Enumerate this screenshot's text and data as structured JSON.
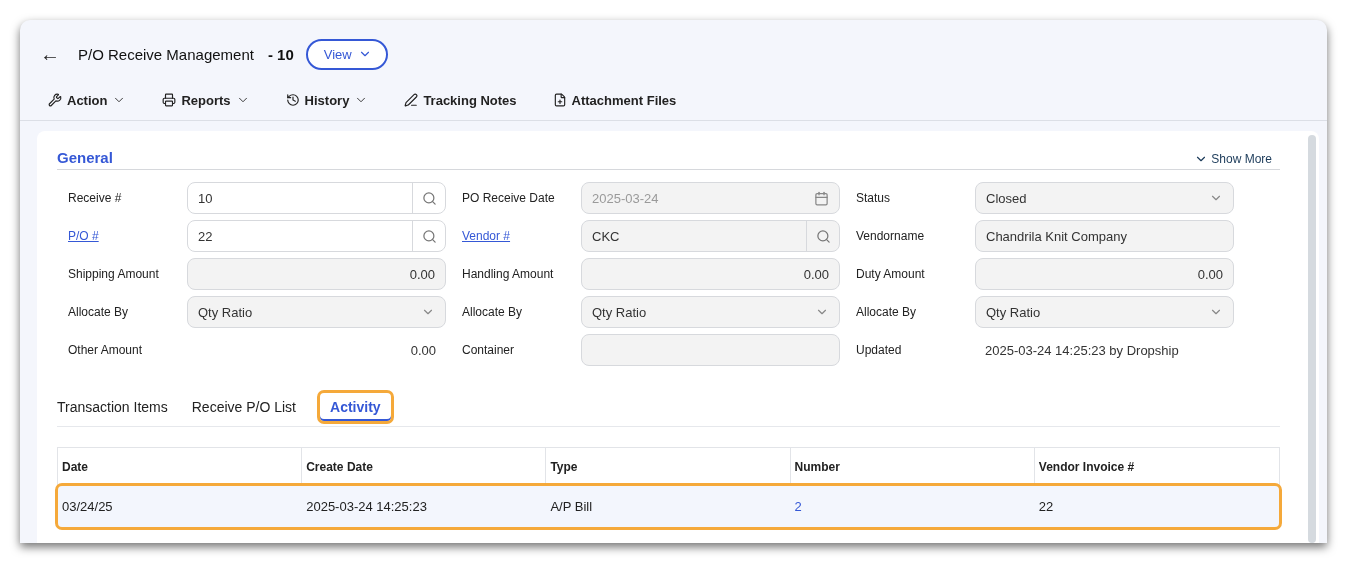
{
  "header": {
    "back": "←",
    "title": "P/O Receive Management",
    "record": "- 10",
    "view_button": "View"
  },
  "toolbar": [
    {
      "kind": "wrench",
      "label": "Action",
      "dropdown": true
    },
    {
      "kind": "printer",
      "label": "Reports",
      "dropdown": true
    },
    {
      "kind": "history",
      "label": "History",
      "dropdown": true
    },
    {
      "kind": "pen",
      "label": "Tracking Notes",
      "dropdown": false
    },
    {
      "kind": "file",
      "label": "Attachment Files",
      "dropdown": false
    }
  ],
  "section": {
    "title": "General",
    "show_more": "Show More"
  },
  "fields": [
    {
      "label": "Receive #",
      "link": false,
      "kind": "search",
      "value": "10",
      "disabled": false
    },
    {
      "label": "PO Receive Date",
      "link": false,
      "kind": "date",
      "value": "2025-03-24",
      "disabled": true
    },
    {
      "label": "Status",
      "link": false,
      "kind": "select",
      "value": "Closed",
      "disabled": true
    },
    {
      "label": "P/O #",
      "link": true,
      "kind": "search",
      "value": "22",
      "disabled": false
    },
    {
      "label": "Vendor #",
      "link": true,
      "kind": "search",
      "value": "CKC",
      "disabled": true
    },
    {
      "label": "Vendorname",
      "link": false,
      "kind": "text",
      "value": "Chandrila Knit Company",
      "disabled": true
    },
    {
      "label": "Shipping Amount",
      "link": false,
      "kind": "amount",
      "value": "0.00",
      "disabled": true
    },
    {
      "label": "Handling Amount",
      "link": false,
      "kind": "amount",
      "value": "0.00",
      "disabled": true
    },
    {
      "label": "Duty Amount",
      "link": false,
      "kind": "amount",
      "value": "0.00",
      "disabled": true
    },
    {
      "label": "Allocate By",
      "link": false,
      "kind": "select",
      "value": "Qty Ratio",
      "disabled": true
    },
    {
      "label": "Allocate By",
      "link": false,
      "kind": "select",
      "value": "Qty Ratio",
      "disabled": true
    },
    {
      "label": "Allocate By",
      "link": false,
      "kind": "select",
      "value": "Qty Ratio",
      "disabled": true
    },
    {
      "label": "Other Amount",
      "link": false,
      "kind": "plain-amount",
      "value": "0.00"
    },
    {
      "label": "Container",
      "link": false,
      "kind": "text",
      "disabled": true
    },
    {
      "label": "Updated",
      "link": false,
      "kind": "plain",
      "value": "2025-03-24 14:25:23 by Dropship"
    }
  ],
  "tabs": [
    {
      "label": "Transaction Items",
      "selected": false,
      "highlighted": false
    },
    {
      "label": "Receive P/O List",
      "selected": false,
      "highlighted": false
    },
    {
      "label": "Activity",
      "selected": true,
      "highlighted": true
    }
  ],
  "table": {
    "columns": [
      "Date",
      "Create Date",
      "Type",
      "Number",
      "Vendor Invoice #"
    ],
    "rows": [
      {
        "cells": [
          {
            "text": "03/24/25",
            "link": false
          },
          {
            "text": "2025-03-24 14:25:23",
            "link": false
          },
          {
            "text": "A/P Bill",
            "link": false
          },
          {
            "text": "2",
            "link": true
          },
          {
            "text": "22",
            "link": false
          }
        ],
        "highlighted": true
      }
    ]
  }
}
